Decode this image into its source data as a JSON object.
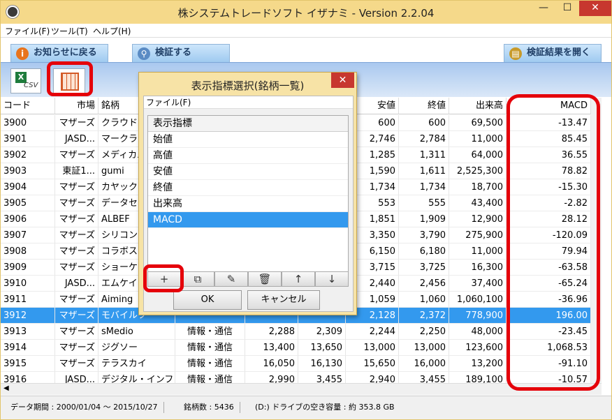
{
  "window": {
    "title": "株システムトレードソフト イザナミ - Version 2.2.04",
    "min": "—",
    "max": "☐",
    "close": "✕"
  },
  "menu": [
    "ファイル(F)",
    "ツール(T)",
    "ヘルプ(H)"
  ],
  "tabs": {
    "left": "お知らせに戻る",
    "mid": "検証する",
    "right": "検証結果を開く"
  },
  "toolbar": {
    "csv": "CSV",
    "excel_mark": "X"
  },
  "table": {
    "headers": [
      "コード",
      "市場",
      "銘柄",
      "",
      "",
      "",
      "安値",
      "終値",
      "出来高",
      "MACD"
    ],
    "rows": [
      [
        "3900",
        "マザーズ",
        "クラウドワ",
        "",
        "",
        "",
        "600",
        "600",
        "69,500",
        "-13.47"
      ],
      [
        "3901",
        "JASD...",
        "マークライ",
        "",
        "",
        "",
        "2,746",
        "2,784",
        "11,000",
        "85.45"
      ],
      [
        "3902",
        "マザーズ",
        "メディカル",
        "",
        "",
        "",
        "1,285",
        "1,311",
        "64,000",
        "36.55"
      ],
      [
        "3903",
        "東証1...",
        "gumi",
        "",
        "",
        "",
        "1,590",
        "1,611",
        "2,525,300",
        "78.82"
      ],
      [
        "3904",
        "マザーズ",
        "カヤック",
        "",
        "",
        "",
        "1,734",
        "1,734",
        "18,700",
        "-15.30"
      ],
      [
        "3905",
        "マザーズ",
        "データセ",
        "",
        "",
        "",
        "553",
        "555",
        "43,400",
        "-2.82"
      ],
      [
        "3906",
        "マザーズ",
        "ALBEF",
        "",
        "",
        "",
        "1,851",
        "1,909",
        "12,900",
        "28.12"
      ],
      [
        "3907",
        "マザーズ",
        "シリコンス",
        "",
        "",
        "",
        "3,350",
        "3,790",
        "275,900",
        "-120.09"
      ],
      [
        "3908",
        "マザーズ",
        "コラボス",
        "",
        "",
        "",
        "6,150",
        "6,180",
        "11,000",
        "79.94"
      ],
      [
        "3909",
        "マザーズ",
        "ショーケ",
        "",
        "",
        "",
        "3,715",
        "3,725",
        "16,300",
        "-63.58"
      ],
      [
        "3910",
        "JASD...",
        "エムケイ",
        "",
        "",
        "",
        "2,440",
        "2,456",
        "37,400",
        "-65.24"
      ],
      [
        "3911",
        "マザーズ",
        "Aiming",
        "",
        "",
        "",
        "1,059",
        "1,060",
        "1,060,100",
        "-36.96"
      ],
      [
        "3912",
        "マザーズ",
        "モバイルフ",
        "",
        "",
        "",
        "2,128",
        "2,372",
        "778,900",
        "196.00"
      ],
      [
        "3913",
        "マザーズ",
        "sMedio",
        "情報・通信",
        "2,288",
        "2,309",
        "2,244",
        "2,250",
        "48,000",
        "-23.45"
      ],
      [
        "3914",
        "マザーズ",
        "ジグソー",
        "情報・通信",
        "13,400",
        "13,650",
        "13,000",
        "13,000",
        "123,600",
        "1,068.53"
      ],
      [
        "3915",
        "マザーズ",
        "テラスカイ",
        "情報・通信",
        "16,050",
        "16,130",
        "15,650",
        "16,000",
        "13,200",
        "-91.10"
      ],
      [
        "3916",
        "JASD...",
        "デジタル・インフ",
        "情報・通信",
        "2,990",
        "3,455",
        "2,940",
        "3,455",
        "189,100",
        "-10.57"
      ]
    ],
    "selected_row": 12
  },
  "status": {
    "period": "データ期間 : 2000/01/04 〜 2015/10/27",
    "count": "銘柄数 : 5436",
    "disk": "(D:) ドライブの空き容量 : 約 353.8 GB"
  },
  "dialog": {
    "title": "表示指標選択(銘柄一覧)",
    "close": "✕",
    "menu": "ファイル(F)",
    "list_header": "表示指標",
    "items": [
      "始値",
      "高値",
      "安値",
      "終値",
      "出来高",
      "MACD"
    ],
    "selected": 5,
    "tools": [
      "+",
      "⧉",
      "✎",
      "🗑",
      "↑",
      "↓"
    ],
    "ok": "OK",
    "cancel": "キャンセル"
  }
}
